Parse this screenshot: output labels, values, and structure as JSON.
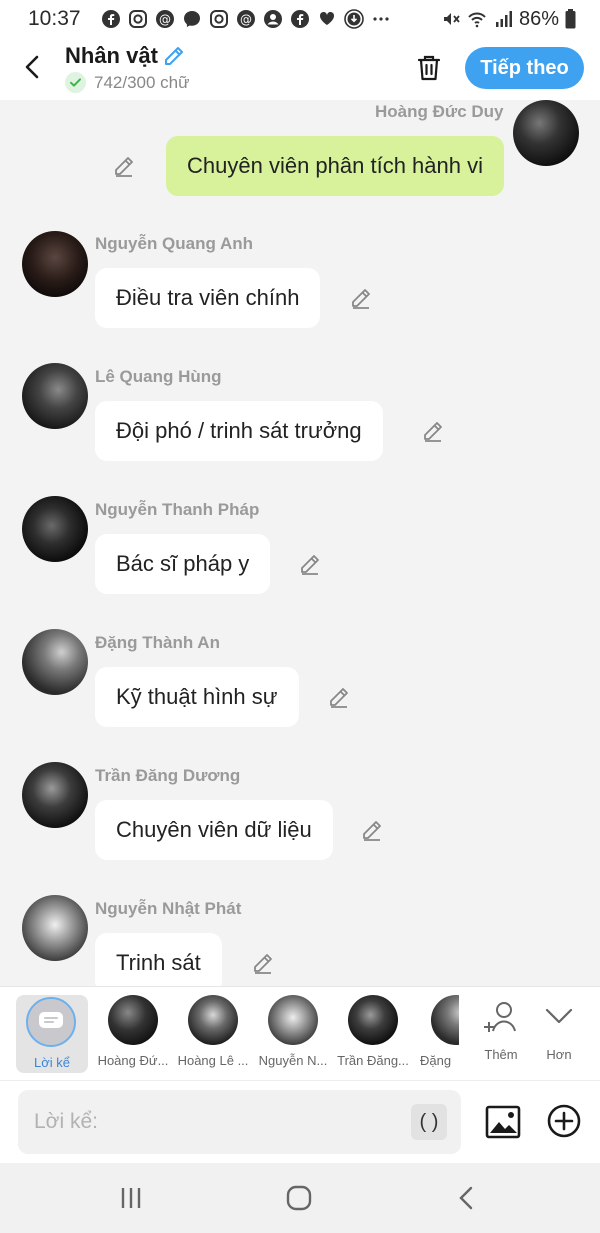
{
  "status_bar": {
    "time": "10:37",
    "battery": "86%"
  },
  "header": {
    "title": "Nhân vật",
    "word_count": "742/300 chữ",
    "next_label": "Tiếp theo"
  },
  "messages": [
    {
      "name": "Hoàng Đức Duy",
      "text": "Chuyên viên phân tích hành vi",
      "self": true
    },
    {
      "name": "Nguyễn Quang Anh",
      "text": "Điều tra viên chính"
    },
    {
      "name": "Lê Quang Hùng",
      "text": "Đội phó / trinh sát trưởng"
    },
    {
      "name": "Nguyễn Thanh Pháp",
      "text": "Bác sĩ pháp y"
    },
    {
      "name": "Đặng Thành An",
      "text": "Kỹ thuật hình sự"
    },
    {
      "name": "Trần Đăng Dương",
      "text": "Chuyên viên dữ liệu"
    },
    {
      "name": "Nguyễn Nhật Phát",
      "text": "Trinh sát"
    }
  ],
  "strip": {
    "narration_label": "Lời kể",
    "characters": [
      "Hoàng Đứ...",
      "Hoàng Lê ...",
      "Nguyễn N...",
      "Trần Đăng...",
      "Đặng"
    ],
    "add_label": "Thêm",
    "more_label": "Hơn"
  },
  "input": {
    "placeholder": "Lời kể:",
    "paren_label": "( )"
  },
  "colors": {
    "accent": "#3ea2f1",
    "self_bubble": "#d7f29a",
    "background": "#f3f3f3"
  },
  "icons": [
    "back-icon",
    "edit-icon",
    "check-icon",
    "trash-icon",
    "image-icon",
    "plus-circle-icon",
    "add-person-icon",
    "chevron-down-icon",
    "menu-icon",
    "home-icon"
  ]
}
